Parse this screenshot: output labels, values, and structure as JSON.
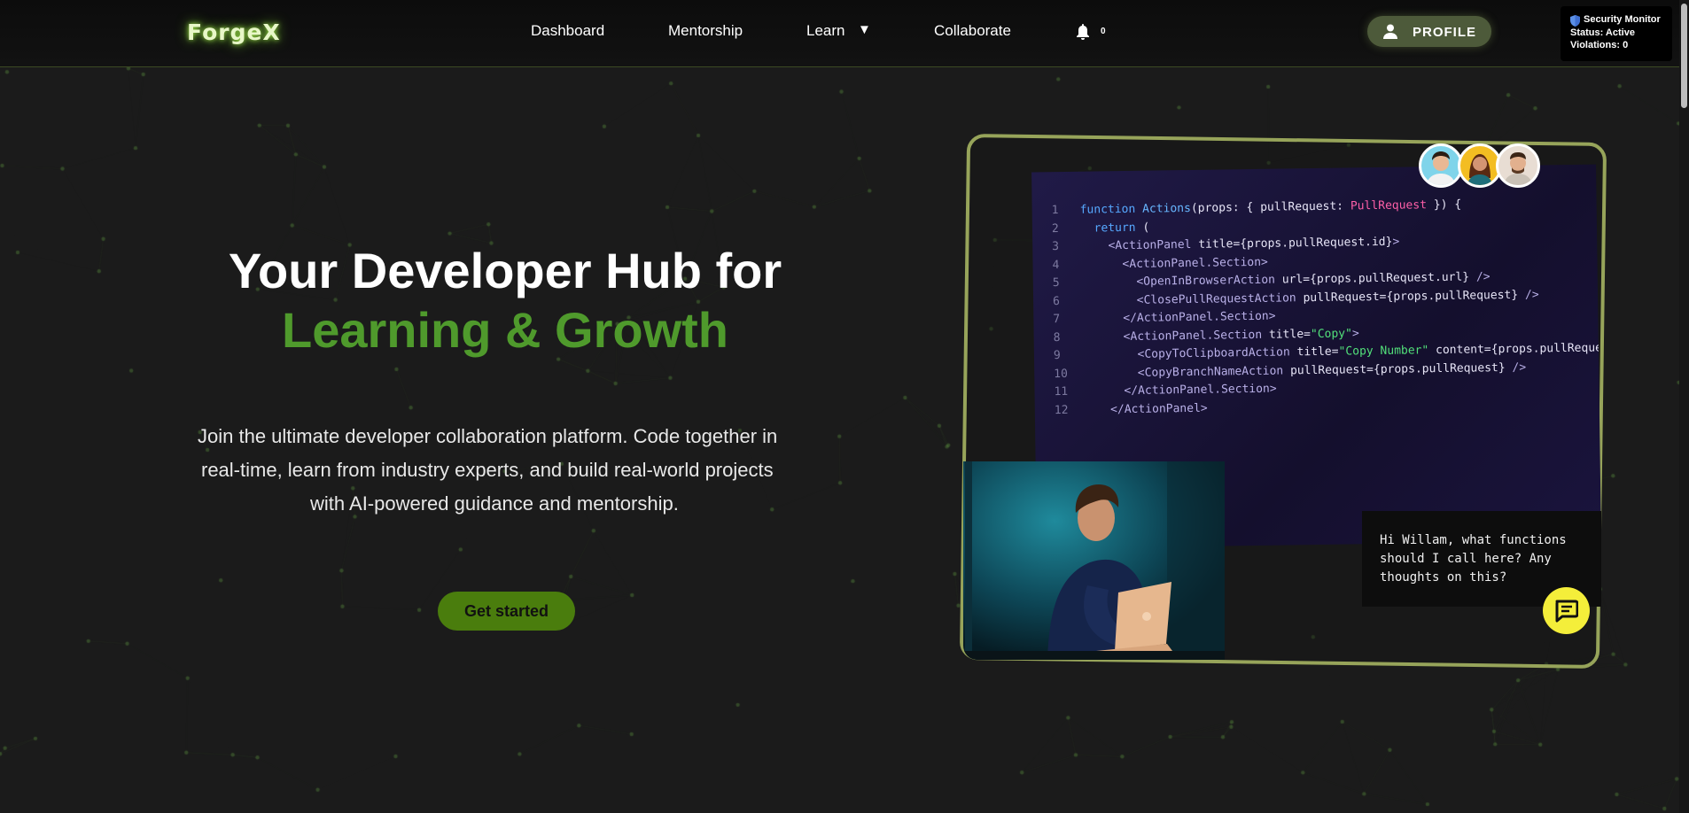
{
  "nav": {
    "logo": "ForgeX",
    "links": [
      "Dashboard",
      "Mentorship",
      "Learn",
      "Collaborate"
    ],
    "learn_caret": "▼",
    "notification_count": "0",
    "profile_label": "PROFILE"
  },
  "security_monitor": {
    "title": "Security Monitor",
    "status": "Status: Active",
    "violations": "Violations: 0"
  },
  "hero": {
    "title_line1": "Your Developer Hub for",
    "title_line2": "Learning & Growth",
    "description_lines": [
      "Join the ultimate developer collaboration platform. Code together in",
      "real-time, learn from industry experts, and build real-world projects",
      "with AI-powered guidance and mentorship."
    ],
    "cta_label": "Get started"
  },
  "showcase": {
    "code_lines": [
      {
        "n": "1",
        "parts": [
          [
            "kw",
            "function "
          ],
          [
            "fn",
            "Actions"
          ],
          [
            "plain",
            "(props: { pullRequest: "
          ],
          [
            "ty",
            "PullRequest"
          ],
          [
            "plain",
            " }) {"
          ]
        ]
      },
      {
        "n": "2",
        "parts": [
          [
            "kw",
            "  return"
          ],
          [
            "plain",
            " ("
          ]
        ]
      },
      {
        "n": "3",
        "parts": [
          [
            "tag",
            "    <ActionPanel "
          ],
          [
            "plain",
            "title={props.pullRequest.id}"
          ],
          [
            "tag",
            ">"
          ]
        ]
      },
      {
        "n": "4",
        "parts": [
          [
            "tag",
            "      <ActionPanel.Section>"
          ]
        ]
      },
      {
        "n": "5",
        "parts": [
          [
            "tag",
            "        <OpenInBrowserAction "
          ],
          [
            "plain",
            "url={props.pullRequest.url} "
          ],
          [
            "tag",
            "/>"
          ]
        ]
      },
      {
        "n": "6",
        "parts": [
          [
            "tag",
            "        <ClosePullRequestAction "
          ],
          [
            "plain",
            "pullRequest={props.pullRequest} "
          ],
          [
            "tag",
            "/>"
          ]
        ]
      },
      {
        "n": "7",
        "parts": [
          [
            "tag",
            "      </ActionPanel.Section>"
          ]
        ]
      },
      {
        "n": "8",
        "parts": [
          [
            "tag",
            "      <ActionPanel.Section "
          ],
          [
            "plain",
            "title="
          ],
          [
            "str",
            "\"Copy\""
          ],
          [
            "tag",
            ">"
          ]
        ]
      },
      {
        "n": "9",
        "parts": [
          [
            "tag",
            "        <CopyToClipboardAction "
          ],
          [
            "plain",
            "title="
          ],
          [
            "str",
            "\"Copy Number\" "
          ],
          [
            "plain",
            "content={props.pullRequest."
          ]
        ]
      },
      {
        "n": "10",
        "parts": [
          [
            "tag",
            "        <CopyBranchNameAction "
          ],
          [
            "plain",
            "pullRequest={props.pullRequest} "
          ],
          [
            "tag",
            "/>"
          ]
        ]
      },
      {
        "n": "11",
        "parts": [
          [
            "tag",
            "      </ActionPanel.Section>"
          ]
        ]
      },
      {
        "n": "12",
        "parts": [
          [
            "tag",
            "    </ActionPanel>"
          ]
        ]
      }
    ],
    "chat_message": "Hi Willam, what functions should I call here? Any thoughts on this?"
  },
  "colors": {
    "accent_green": "#4f9a2c",
    "cta_green": "#4a7d0d",
    "frame_olive": "#97a45a",
    "chat_yellow": "#f4ee3a"
  },
  "icons": [
    "bell-icon",
    "user-icon",
    "shield-icon",
    "chat-icon"
  ]
}
